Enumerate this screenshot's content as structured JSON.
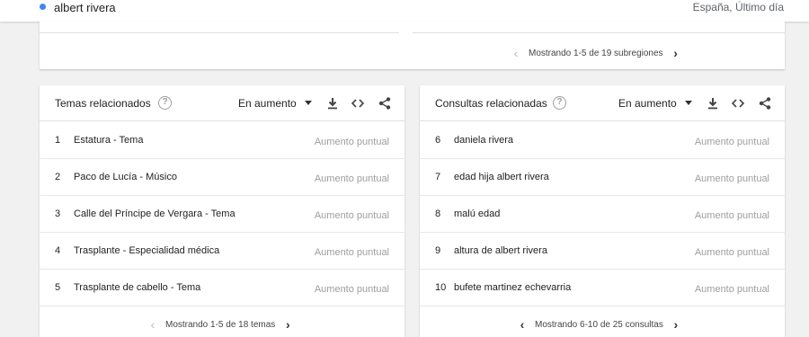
{
  "header": {
    "term": "albert rivera",
    "region": "España, Último día",
    "term_color": "#4285f4"
  },
  "top_card": {
    "pager_text": "Mostrando 1-5 de 19 subregiones"
  },
  "topics": {
    "title": "Temas relacionados",
    "filter": "En aumento",
    "rows": [
      {
        "num": "1",
        "label": "Estatura - Tema",
        "value": "Aumento puntual"
      },
      {
        "num": "2",
        "label": "Paco de Lucía - Músico",
        "value": "Aumento puntual"
      },
      {
        "num": "3",
        "label": "Calle del Príncipe de Vergara - Tema",
        "value": "Aumento puntual"
      },
      {
        "num": "4",
        "label": "Trasplante - Especialidad médica",
        "value": "Aumento puntual"
      },
      {
        "num": "5",
        "label": "Trasplante de cabello - Tema",
        "value": "Aumento puntual"
      }
    ],
    "pager_text": "Mostrando 1-5 de 18 temas"
  },
  "queries": {
    "title": "Consultas relacionadas",
    "filter": "En aumento",
    "rows": [
      {
        "num": "6",
        "label": "daniela rivera",
        "value": "Aumento puntual"
      },
      {
        "num": "7",
        "label": "edad hija albert rivera",
        "value": "Aumento puntual"
      },
      {
        "num": "8",
        "label": "malú edad",
        "value": "Aumento puntual"
      },
      {
        "num": "9",
        "label": "altura de albert rivera",
        "value": "Aumento puntual"
      },
      {
        "num": "10",
        "label": "bufete martinez echevarria",
        "value": "Aumento puntual"
      }
    ],
    "pager_text": "Mostrando 6-10 de 25 consultas"
  },
  "icons": {
    "help": "help-circle-icon",
    "download": "download-icon",
    "embed": "embed-code-icon",
    "share": "share-icon",
    "prev": "chevron-left-icon",
    "next": "chevron-right-icon"
  }
}
